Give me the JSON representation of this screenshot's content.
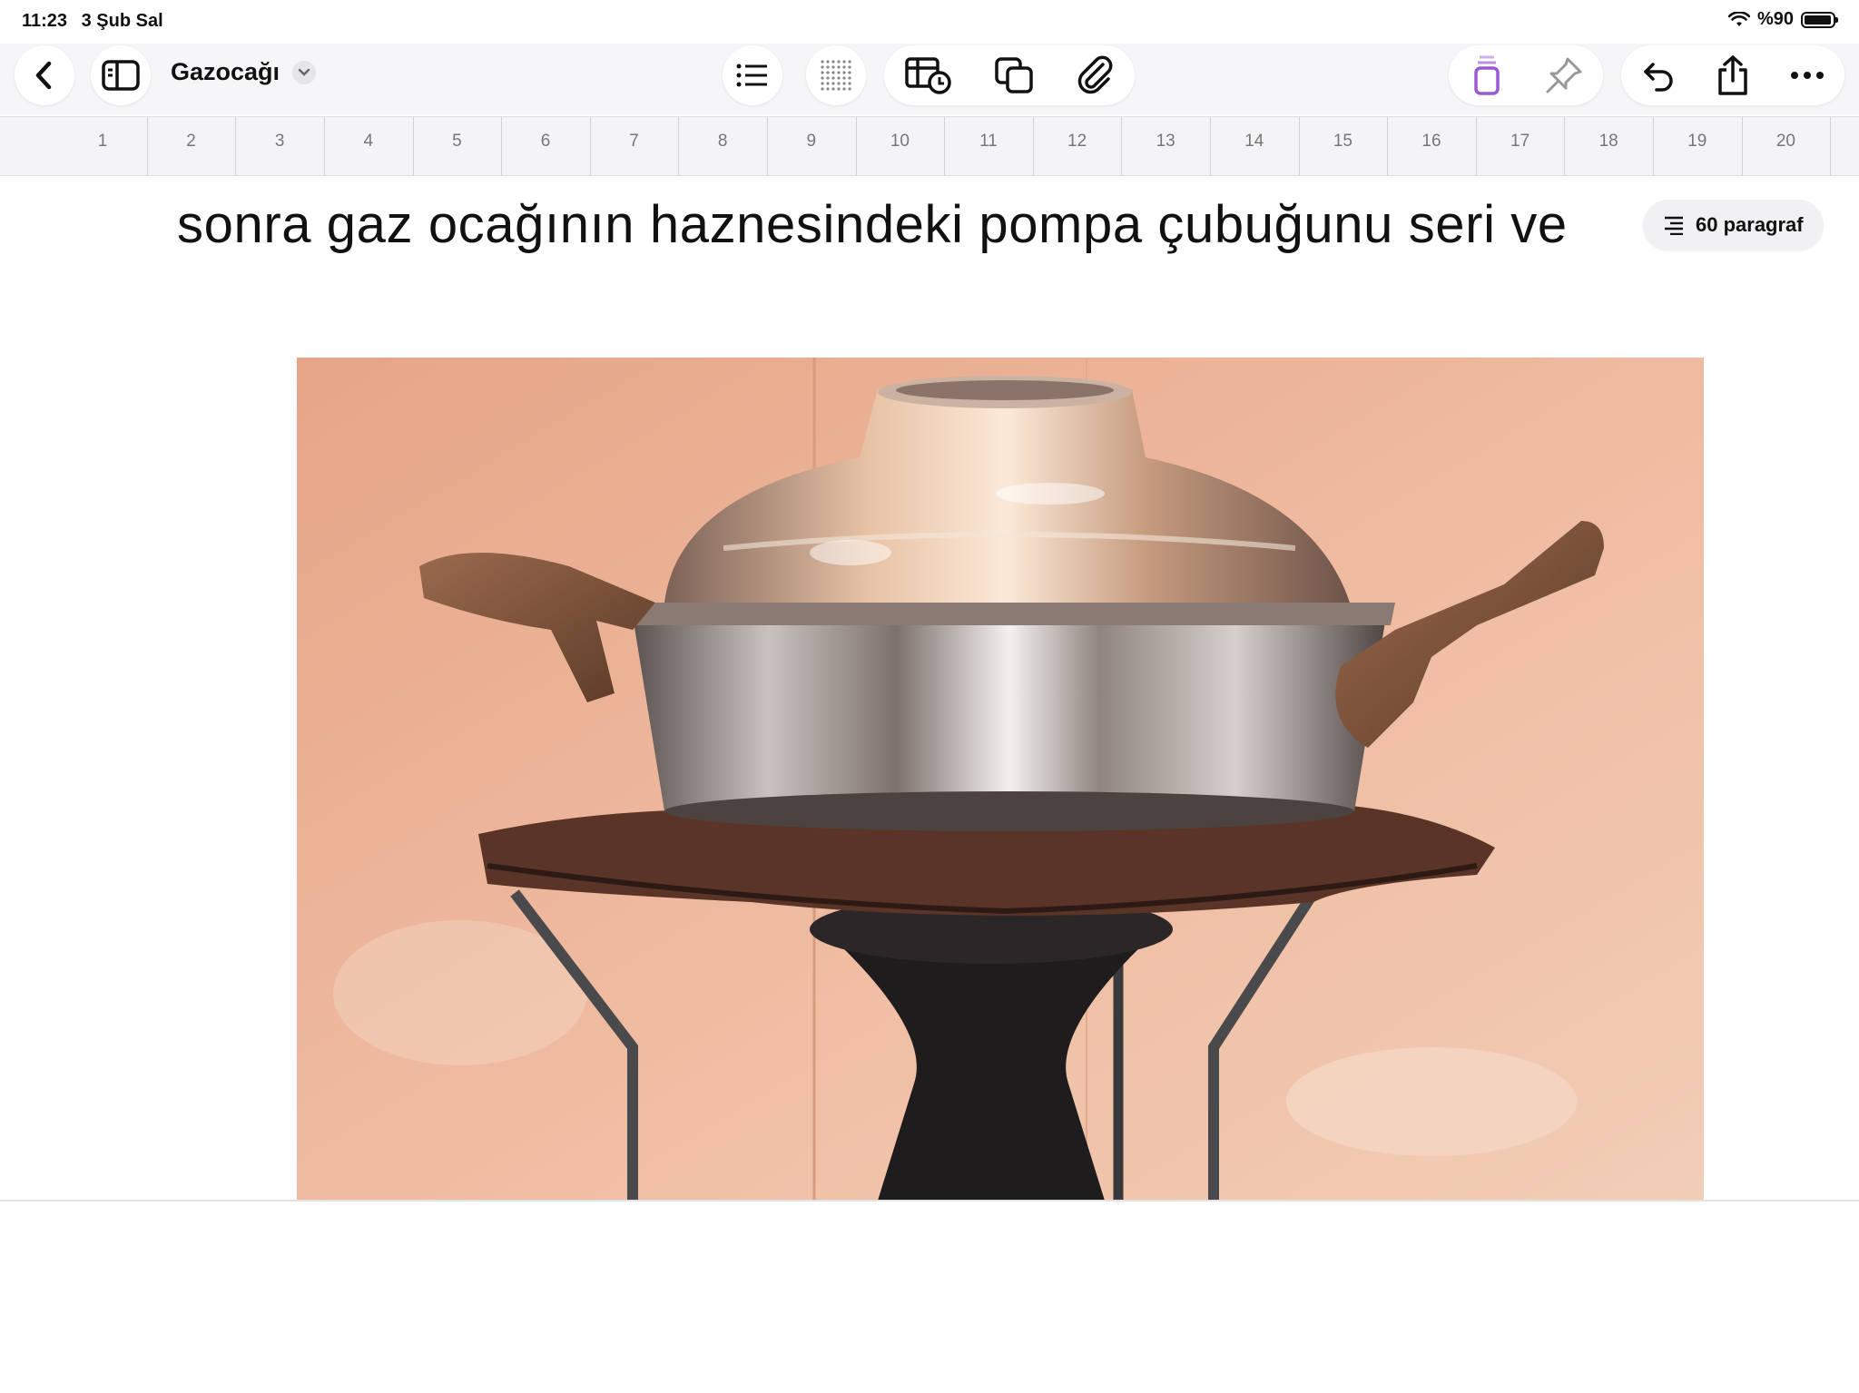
{
  "status_bar": {
    "time": "11:23",
    "date": "3 Şub Sal",
    "battery": "%90"
  },
  "toolbar": {
    "back_icon": "chevron-left-icon",
    "sidebar_icon": "sidebar-icon",
    "document_title": "Gazocağı",
    "title_menu_icon": "chevron-down-icon",
    "list_icon": "list-icon",
    "grid_icon": "dot-grid-icon",
    "table_icon": "table-clock-icon",
    "shapes_icon": "layers-icon",
    "attach_icon": "paperclip-icon",
    "format_icon": "paintbrush-icon",
    "pin_icon": "pin-icon",
    "undo_icon": "undo-icon",
    "share_icon": "share-icon",
    "more_icon": "more-icon",
    "accent_color": "#9b59d6"
  },
  "ruler": {
    "numbers": [
      "1",
      "2",
      "3",
      "4",
      "5",
      "6",
      "7",
      "8",
      "9",
      "10",
      "11",
      "12",
      "13",
      "14",
      "15",
      "16",
      "17",
      "18",
      "19",
      "20"
    ]
  },
  "document": {
    "line": "sonra gaz ocağının haznesindeki pompa çubuğunu seri ve",
    "paragraph_count": "60 paragraf",
    "image_alt": "Metal cooking pot with handles sitting on a vintage kerosene stove"
  }
}
